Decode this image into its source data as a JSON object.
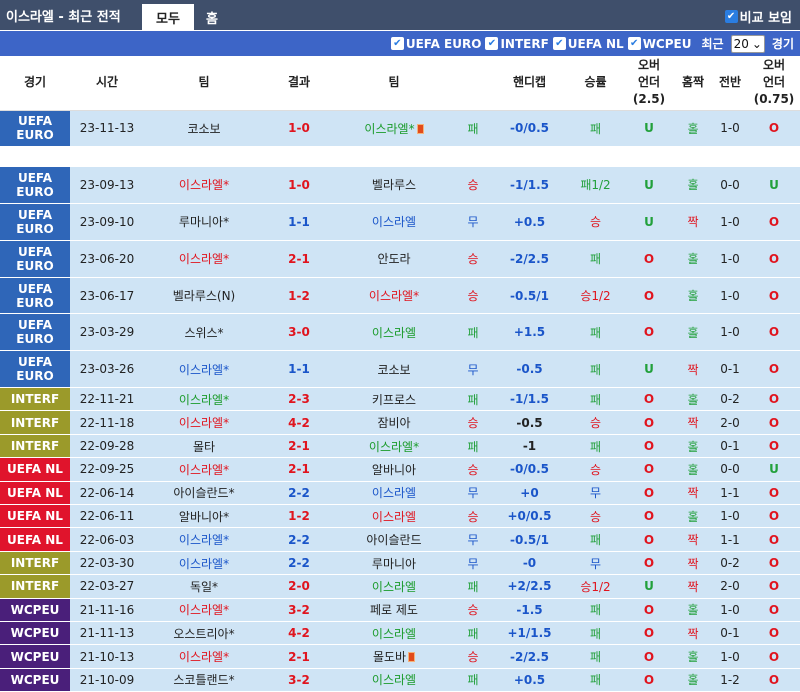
{
  "header": {
    "title": "이스라엘 - 최근 전적",
    "tabs": [
      "모두",
      "홈"
    ],
    "compare_label": "비교 보임"
  },
  "filters": {
    "items": [
      "UEFA EURO",
      "INTERF",
      "UEFA NL",
      "WCPEU"
    ],
    "recent_label": "최근",
    "recent_value": "20",
    "unit": "경기"
  },
  "columns": [
    "경기",
    "시간",
    "팀",
    "결과",
    "팀",
    "",
    "핸디캡",
    "승률",
    "오버\n언더\n(2.5)",
    "홈짝",
    "전반",
    "오버\n언더\n(0.75)"
  ],
  "league_colors": {
    "UEFA EURO": "#2f66b8",
    "INTERF": "#9b9a2a",
    "UEFA NL": "#e0142c",
    "WCPEU": "#4a1f7a"
  },
  "rows": [
    {
      "league": "UEFA EURO",
      "date": "23-11-13",
      "home": "코소보",
      "home_c": "dark",
      "home_mark": "",
      "score": "1-0",
      "score_c": "red",
      "away": "이스라엘*",
      "away_c": "green",
      "away_card": true,
      "res": "패",
      "res_c": "g",
      "hc": "-0/0.5",
      "hc_c": "b",
      "wr": "패",
      "wr_c": "g",
      "ou": "U",
      "ou_c": "g",
      "oe": "홀",
      "oe_c": "g",
      "half": "1-0",
      "ou2": "O",
      "ou2_c": "r",
      "tall": true
    },
    {
      "gap": true
    },
    {
      "league": "UEFA EURO",
      "date": "23-09-13",
      "home": "이스라엘*",
      "home_c": "red",
      "score": "1-0",
      "score_c": "red",
      "away": "벨라루스",
      "away_c": "dark",
      "res": "승",
      "res_c": "r",
      "hc": "-1/1.5",
      "hc_c": "b",
      "wr": "패1/2",
      "wr_c": "g",
      "ou": "U",
      "ou_c": "g",
      "oe": "홀",
      "oe_c": "g",
      "half": "0-0",
      "ou2": "U",
      "ou2_c": "g",
      "tall": true
    },
    {
      "league": "UEFA EURO",
      "date": "23-09-10",
      "home": "루마니아*",
      "home_c": "dark",
      "score": "1-1",
      "score_c": "blue",
      "away": "이스라엘",
      "away_c": "blue",
      "res": "무",
      "res_c": "b",
      "hc": "+0.5",
      "hc_c": "b",
      "wr": "승",
      "wr_c": "r",
      "ou": "U",
      "ou_c": "g",
      "oe": "짝",
      "oe_c": "r",
      "half": "1-0",
      "ou2": "O",
      "ou2_c": "r",
      "tall": true
    },
    {
      "league": "UEFA EURO",
      "date": "23-06-20",
      "home": "이스라엘*",
      "home_c": "red",
      "score": "2-1",
      "score_c": "red",
      "away": "안도라",
      "away_c": "dark",
      "res": "승",
      "res_c": "r",
      "hc": "-2/2.5",
      "hc_c": "b",
      "wr": "패",
      "wr_c": "g",
      "ou": "O",
      "ou_c": "r",
      "oe": "홀",
      "oe_c": "g",
      "half": "1-0",
      "ou2": "O",
      "ou2_c": "r",
      "tall": true
    },
    {
      "league": "UEFA EURO",
      "date": "23-06-17",
      "home": "벨라루스(N)",
      "home_c": "dark",
      "score": "1-2",
      "score_c": "red",
      "away": "이스라엘*",
      "away_c": "red",
      "res": "승",
      "res_c": "r",
      "hc": "-0.5/1",
      "hc_c": "b",
      "wr": "승1/2",
      "wr_c": "r",
      "ou": "O",
      "ou_c": "r",
      "oe": "홀",
      "oe_c": "g",
      "half": "1-0",
      "ou2": "O",
      "ou2_c": "r",
      "tall": true
    },
    {
      "league": "UEFA EURO",
      "date": "23-03-29",
      "home": "스위스*",
      "home_c": "dark",
      "score": "3-0",
      "score_c": "red",
      "away": "이스라엘",
      "away_c": "green",
      "res": "패",
      "res_c": "g",
      "hc": "+1.5",
      "hc_c": "b",
      "wr": "패",
      "wr_c": "g",
      "ou": "O",
      "ou_c": "r",
      "oe": "홀",
      "oe_c": "g",
      "half": "1-0",
      "ou2": "O",
      "ou2_c": "r",
      "tall": true
    },
    {
      "league": "UEFA EURO",
      "date": "23-03-26",
      "home": "이스라엘*",
      "home_c": "blue",
      "score": "1-1",
      "score_c": "blue",
      "away": "코소보",
      "away_c": "dark",
      "res": "무",
      "res_c": "b",
      "hc": "-0.5",
      "hc_c": "b",
      "wr": "패",
      "wr_c": "g",
      "ou": "U",
      "ou_c": "g",
      "oe": "짝",
      "oe_c": "r",
      "half": "0-1",
      "ou2": "O",
      "ou2_c": "r",
      "tall": true
    },
    {
      "league": "INTERF",
      "date": "22-11-21",
      "home": "이스라엘*",
      "home_c": "green",
      "score": "2-3",
      "score_c": "red",
      "away": "키프로스",
      "away_c": "dark",
      "res": "패",
      "res_c": "g",
      "hc": "-1/1.5",
      "hc_c": "b",
      "wr": "패",
      "wr_c": "g",
      "ou": "O",
      "ou_c": "r",
      "oe": "홀",
      "oe_c": "g",
      "half": "0-2",
      "ou2": "O",
      "ou2_c": "r"
    },
    {
      "league": "INTERF",
      "date": "22-11-18",
      "home": "이스라엘*",
      "home_c": "red",
      "score": "4-2",
      "score_c": "red",
      "away": "잠비아",
      "away_c": "dark",
      "res": "승",
      "res_c": "r",
      "hc": "-0.5",
      "hc_c": "dark",
      "wr": "승",
      "wr_c": "r",
      "ou": "O",
      "ou_c": "r",
      "oe": "짝",
      "oe_c": "r",
      "half": "2-0",
      "ou2": "O",
      "ou2_c": "r"
    },
    {
      "league": "INTERF",
      "date": "22-09-28",
      "home": "몰타",
      "home_c": "dark",
      "score": "2-1",
      "score_c": "red",
      "away": "이스라엘*",
      "away_c": "green",
      "res": "패",
      "res_c": "g",
      "hc": "-1",
      "hc_c": "dark",
      "wr": "패",
      "wr_c": "g",
      "ou": "O",
      "ou_c": "r",
      "oe": "홀",
      "oe_c": "g",
      "half": "0-1",
      "ou2": "O",
      "ou2_c": "r"
    },
    {
      "league": "UEFA NL",
      "date": "22-09-25",
      "home": "이스라엘*",
      "home_c": "red",
      "score": "2-1",
      "score_c": "red",
      "away": "알바니아",
      "away_c": "dark",
      "res": "승",
      "res_c": "r",
      "hc": "-0/0.5",
      "hc_c": "b",
      "wr": "승",
      "wr_c": "r",
      "ou": "O",
      "ou_c": "r",
      "oe": "홀",
      "oe_c": "g",
      "half": "0-0",
      "ou2": "U",
      "ou2_c": "g"
    },
    {
      "league": "UEFA NL",
      "date": "22-06-14",
      "home": "아이슬란드*",
      "home_c": "dark",
      "score": "2-2",
      "score_c": "blue",
      "away": "이스라엘",
      "away_c": "blue",
      "res": "무",
      "res_c": "b",
      "hc": "+0",
      "hc_c": "b",
      "wr": "무",
      "wr_c": "b",
      "ou": "O",
      "ou_c": "r",
      "oe": "짝",
      "oe_c": "r",
      "half": "1-1",
      "ou2": "O",
      "ou2_c": "r"
    },
    {
      "league": "UEFA NL",
      "date": "22-06-11",
      "home": "알바니아*",
      "home_c": "dark",
      "score": "1-2",
      "score_c": "red",
      "away": "이스라엘",
      "away_c": "red",
      "res": "승",
      "res_c": "r",
      "hc": "+0/0.5",
      "hc_c": "b",
      "wr": "승",
      "wr_c": "r",
      "ou": "O",
      "ou_c": "r",
      "oe": "홀",
      "oe_c": "g",
      "half": "1-0",
      "ou2": "O",
      "ou2_c": "r"
    },
    {
      "league": "UEFA NL",
      "date": "22-06-03",
      "home": "이스라엘*",
      "home_c": "blue",
      "score": "2-2",
      "score_c": "blue",
      "away": "아이슬란드",
      "away_c": "dark",
      "res": "무",
      "res_c": "b",
      "hc": "-0.5/1",
      "hc_c": "b",
      "wr": "패",
      "wr_c": "g",
      "ou": "O",
      "ou_c": "r",
      "oe": "짝",
      "oe_c": "r",
      "half": "1-1",
      "ou2": "O",
      "ou2_c": "r"
    },
    {
      "league": "INTERF",
      "date": "22-03-30",
      "home": "이스라엘*",
      "home_c": "blue",
      "score": "2-2",
      "score_c": "blue",
      "away": "루마니아",
      "away_c": "dark",
      "res": "무",
      "res_c": "b",
      "hc": "-0",
      "hc_c": "b",
      "wr": "무",
      "wr_c": "b",
      "ou": "O",
      "ou_c": "r",
      "oe": "짝",
      "oe_c": "r",
      "half": "0-2",
      "ou2": "O",
      "ou2_c": "r"
    },
    {
      "league": "INTERF",
      "date": "22-03-27",
      "home": "독일*",
      "home_c": "dark",
      "score": "2-0",
      "score_c": "red",
      "away": "이스라엘",
      "away_c": "green",
      "res": "패",
      "res_c": "g",
      "hc": "+2/2.5",
      "hc_c": "b",
      "wr": "승1/2",
      "wr_c": "r",
      "ou": "U",
      "ou_c": "g",
      "oe": "짝",
      "oe_c": "r",
      "half": "2-0",
      "ou2": "O",
      "ou2_c": "r"
    },
    {
      "league": "WCPEU",
      "date": "21-11-16",
      "home": "이스라엘*",
      "home_c": "red",
      "score": "3-2",
      "score_c": "red",
      "away": "페로 제도",
      "away_c": "dark",
      "res": "승",
      "res_c": "r",
      "hc": "-1.5",
      "hc_c": "b",
      "wr": "패",
      "wr_c": "g",
      "ou": "O",
      "ou_c": "r",
      "oe": "홀",
      "oe_c": "g",
      "half": "1-0",
      "ou2": "O",
      "ou2_c": "r"
    },
    {
      "league": "WCPEU",
      "date": "21-11-13",
      "home": "오스트리아*",
      "home_c": "dark",
      "score": "4-2",
      "score_c": "red",
      "away": "이스라엘",
      "away_c": "green",
      "res": "패",
      "res_c": "g",
      "hc": "+1/1.5",
      "hc_c": "b",
      "wr": "패",
      "wr_c": "g",
      "ou": "O",
      "ou_c": "r",
      "oe": "짝",
      "oe_c": "r",
      "half": "0-1",
      "ou2": "O",
      "ou2_c": "r"
    },
    {
      "league": "WCPEU",
      "date": "21-10-13",
      "home": "이스라엘*",
      "home_c": "red",
      "score": "2-1",
      "score_c": "red",
      "away": "몰도바",
      "away_c": "dark",
      "away_card": true,
      "res": "승",
      "res_c": "r",
      "hc": "-2/2.5",
      "hc_c": "b",
      "wr": "패",
      "wr_c": "g",
      "ou": "O",
      "ou_c": "r",
      "oe": "홀",
      "oe_c": "g",
      "half": "1-0",
      "ou2": "O",
      "ou2_c": "r"
    },
    {
      "league": "WCPEU",
      "date": "21-10-09",
      "home": "스코틀랜드*",
      "home_c": "dark",
      "score": "3-2",
      "score_c": "red",
      "away": "이스라엘",
      "away_c": "green",
      "res": "패",
      "res_c": "g",
      "hc": "+0.5",
      "hc_c": "b",
      "wr": "패",
      "wr_c": "g",
      "ou": "O",
      "ou_c": "r",
      "oe": "홀",
      "oe_c": "g",
      "half": "1-2",
      "ou2": "O",
      "ou2_c": "r"
    }
  ]
}
